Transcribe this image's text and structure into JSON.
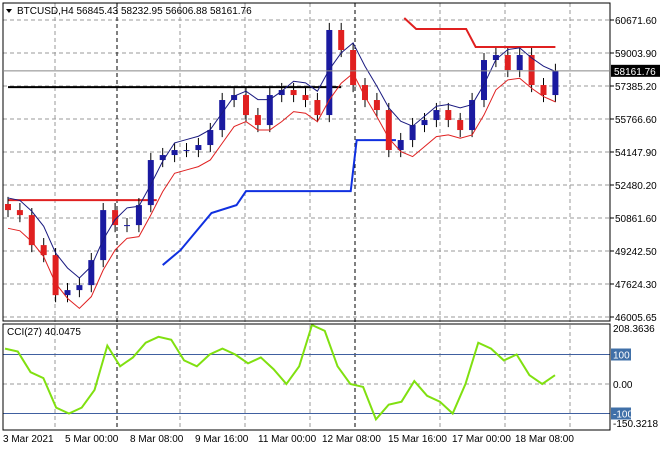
{
  "header": {
    "symbol": "BTCUSD,H4",
    "open": "56845.43",
    "high": "58232.95",
    "low": "56606.88",
    "close": "58161.76"
  },
  "price_axis": {
    "labels": [
      "60671.60",
      "59003.90",
      "57385.20",
      "55766.60",
      "54147.90",
      "52480.20",
      "50861.60",
      "49242.50",
      "47624.30",
      "46005.65"
    ],
    "max": 60671.6,
    "min": 46005.65,
    "current": "58161.76"
  },
  "cci": {
    "label": "CCI(27) 40.0475",
    "max_label": "208.3636",
    "min_label": "-150.3218",
    "level_hi": "100",
    "level_zero": "0.00",
    "level_lo": "-100",
    "values": [
      120,
      110,
      40,
      20,
      -80,
      -100,
      -80,
      -20,
      130,
      60,
      90,
      140,
      160,
      150,
      80,
      60,
      100,
      120,
      100,
      70,
      90,
      50,
      0,
      60,
      200,
      180,
      60,
      0,
      -10,
      -120,
      -70,
      -60,
      10,
      -40,
      -60,
      -100,
      0,
      140,
      120,
      80,
      100,
      30,
      0,
      30
    ]
  },
  "time_axis": [
    "3 Mar 2021",
    "5 Mar 00:00",
    "8 Mar 08:00",
    "9 Mar 16:00",
    "11 Mar 00:00",
    "12 Mar 08:00",
    "15 Mar 16:00",
    "17 Mar 00:00",
    "18 Mar 08:00"
  ],
  "closes": [
    51285,
    51038,
    49556,
    49062,
    47085,
    47334,
    47580,
    48816,
    51285,
    50544,
    50544,
    51532,
    53756,
    54003,
    54250,
    54250,
    54497,
    55238,
    56720,
    56966,
    55978,
    55484,
    56966,
    57214,
    56966,
    56720,
    55978,
    60178,
    59190,
    57460,
    56720,
    56226,
    54250,
    54744,
    55484,
    55732,
    56226,
    55732,
    55238,
    56720,
    58695,
    58942,
    58201,
    58942,
    57460,
    56966,
    58161
  ],
  "levels": {
    "support_red": [
      [
        0,
        51780
      ],
      [
        12.5,
        51780
      ]
    ],
    "resistance_black": [
      [
        0,
        57360
      ],
      [
        28,
        57360
      ]
    ],
    "upper_red": [
      [
        33.3,
        60770
      ],
      [
        34.3,
        60230
      ],
      [
        38.5,
        60230
      ],
      [
        39.3,
        59340
      ],
      [
        46,
        59340
      ]
    ],
    "blue_step": [
      [
        13,
        48570
      ],
      [
        14.5,
        49310
      ],
      [
        17.1,
        51140
      ],
      [
        19.2,
        51530
      ],
      [
        20,
        52220
      ],
      [
        28.8,
        52220
      ],
      [
        29.3,
        54740
      ],
      [
        32.6,
        54740
      ]
    ]
  },
  "colors": {
    "bull": "#1a1aa0",
    "bear": "#e02020",
    "cci": "#80e010",
    "ma_fast": "#1a1a80",
    "ma_slow": "#e02020"
  }
}
